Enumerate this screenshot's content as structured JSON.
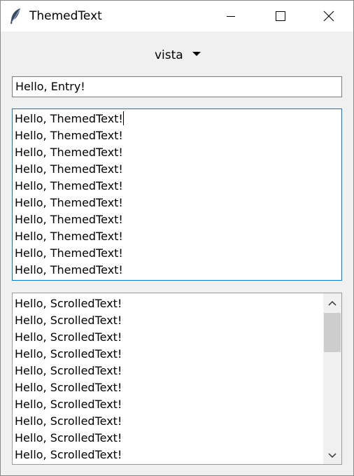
{
  "window": {
    "title": "ThemedText",
    "icon": "feather-icon",
    "controls": [
      "minimize-icon",
      "maximize-icon",
      "close-icon"
    ]
  },
  "theme_selector": {
    "value": "vista",
    "icon": "dropdown-arrow-icon"
  },
  "entry": {
    "value": "Hello, Entry!"
  },
  "themed_text": {
    "lines": [
      "Hello, ThemedText!",
      "Hello, ThemedText!",
      "Hello, ThemedText!",
      "Hello, ThemedText!",
      "Hello, ThemedText!",
      "Hello, ThemedText!",
      "Hello, ThemedText!",
      "Hello, ThemedText!",
      "Hello, ThemedText!",
      "Hello, ThemedText!"
    ]
  },
  "scrolled_text": {
    "lines": [
      "Hello, ScrolledText!",
      "Hello, ScrolledText!",
      "Hello, ScrolledText!",
      "Hello, ScrolledText!",
      "Hello, ScrolledText!",
      "Hello, ScrolledText!",
      "Hello, ScrolledText!",
      "Hello, ScrolledText!",
      "Hello, ScrolledText!",
      "Hello, ScrolledText!"
    ]
  },
  "colors": {
    "window_bg": "#f0f0f0",
    "focus_border": "#0078d7",
    "scroll_thumb": "#cdcdcd"
  }
}
